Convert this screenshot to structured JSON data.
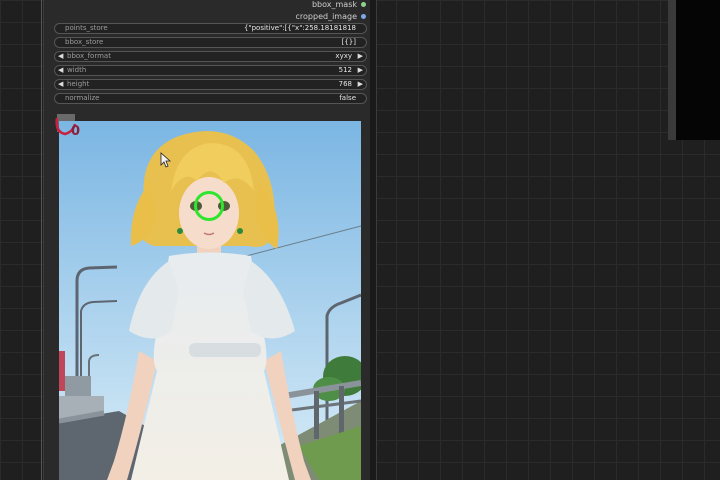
{
  "outputs": [
    {
      "label": "bbox_mask"
    },
    {
      "label": "cropped_image"
    }
  ],
  "widgets": {
    "points_store": {
      "label": "points_store",
      "value": "{\"positive\":[{\"x\":258.18181818"
    },
    "bbox_store": {
      "label": "bbox_store",
      "value": "[{}]"
    },
    "bbox_format": {
      "label": "bbox_format",
      "value": "xyxy"
    },
    "width": {
      "label": "width",
      "value": "512"
    },
    "height": {
      "label": "height",
      "value": "768"
    },
    "normalize": {
      "label": "normalize",
      "value": "false"
    }
  },
  "canvas": {
    "bbox_index_label": "0"
  },
  "colors": {
    "positive_point": "#2ee62e",
    "bbox_marker": "#8c1f3b",
    "background": "#1f1f1f",
    "node_body": "#2a2a2a"
  },
  "icons": {
    "decrement": "triangle-left",
    "increment": "triangle-right",
    "pointer": "mouse-cursor"
  }
}
